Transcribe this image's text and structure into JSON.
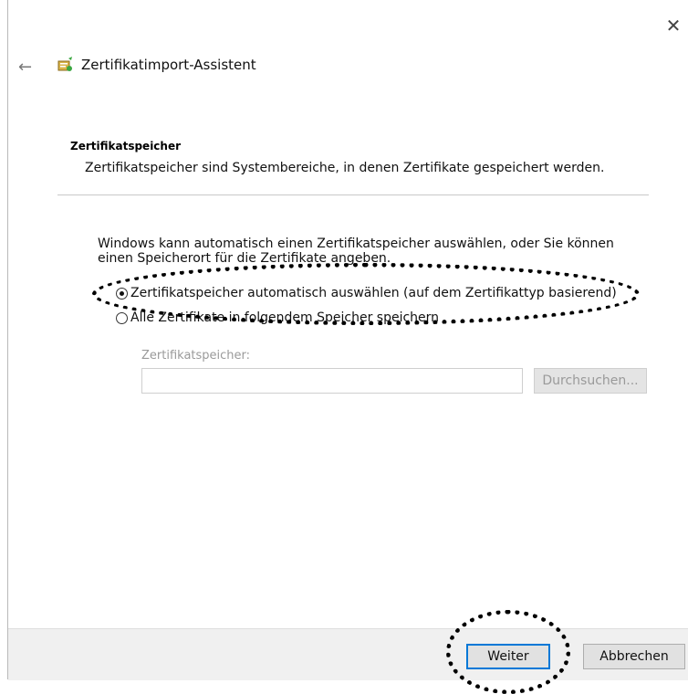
{
  "window": {
    "close_glyph": "✕"
  },
  "header": {
    "back_glyph": "←",
    "title": "Zertifikatimport-Assistent"
  },
  "section": {
    "title": "Zertifikatspeicher",
    "description": "Zertifikatspeicher sind Systembereiche, in denen Zertifikate gespeichert werden."
  },
  "content": {
    "intro": "Windows kann automatisch einen Zertifikatspeicher auswählen, oder Sie können einen Speicherort für die Zertifikate angeben.",
    "options": [
      {
        "label": "Zertifikatspeicher automatisch auswählen (auf dem Zertifikattyp basierend)",
        "checked": true
      },
      {
        "label": "Alle Zertifikate in folgendem Speicher speichern",
        "checked": false
      }
    ],
    "store_label": "Zertifikatspeicher:",
    "store_value": "",
    "browse_label": "Durchsuchen..."
  },
  "footer": {
    "next_label": "Weiter",
    "cancel_label": "Abbrechen"
  },
  "colors": {
    "accent": "#0078d7",
    "footer_bg": "#f0f0f0",
    "disabled_text": "#9a9a9a"
  }
}
